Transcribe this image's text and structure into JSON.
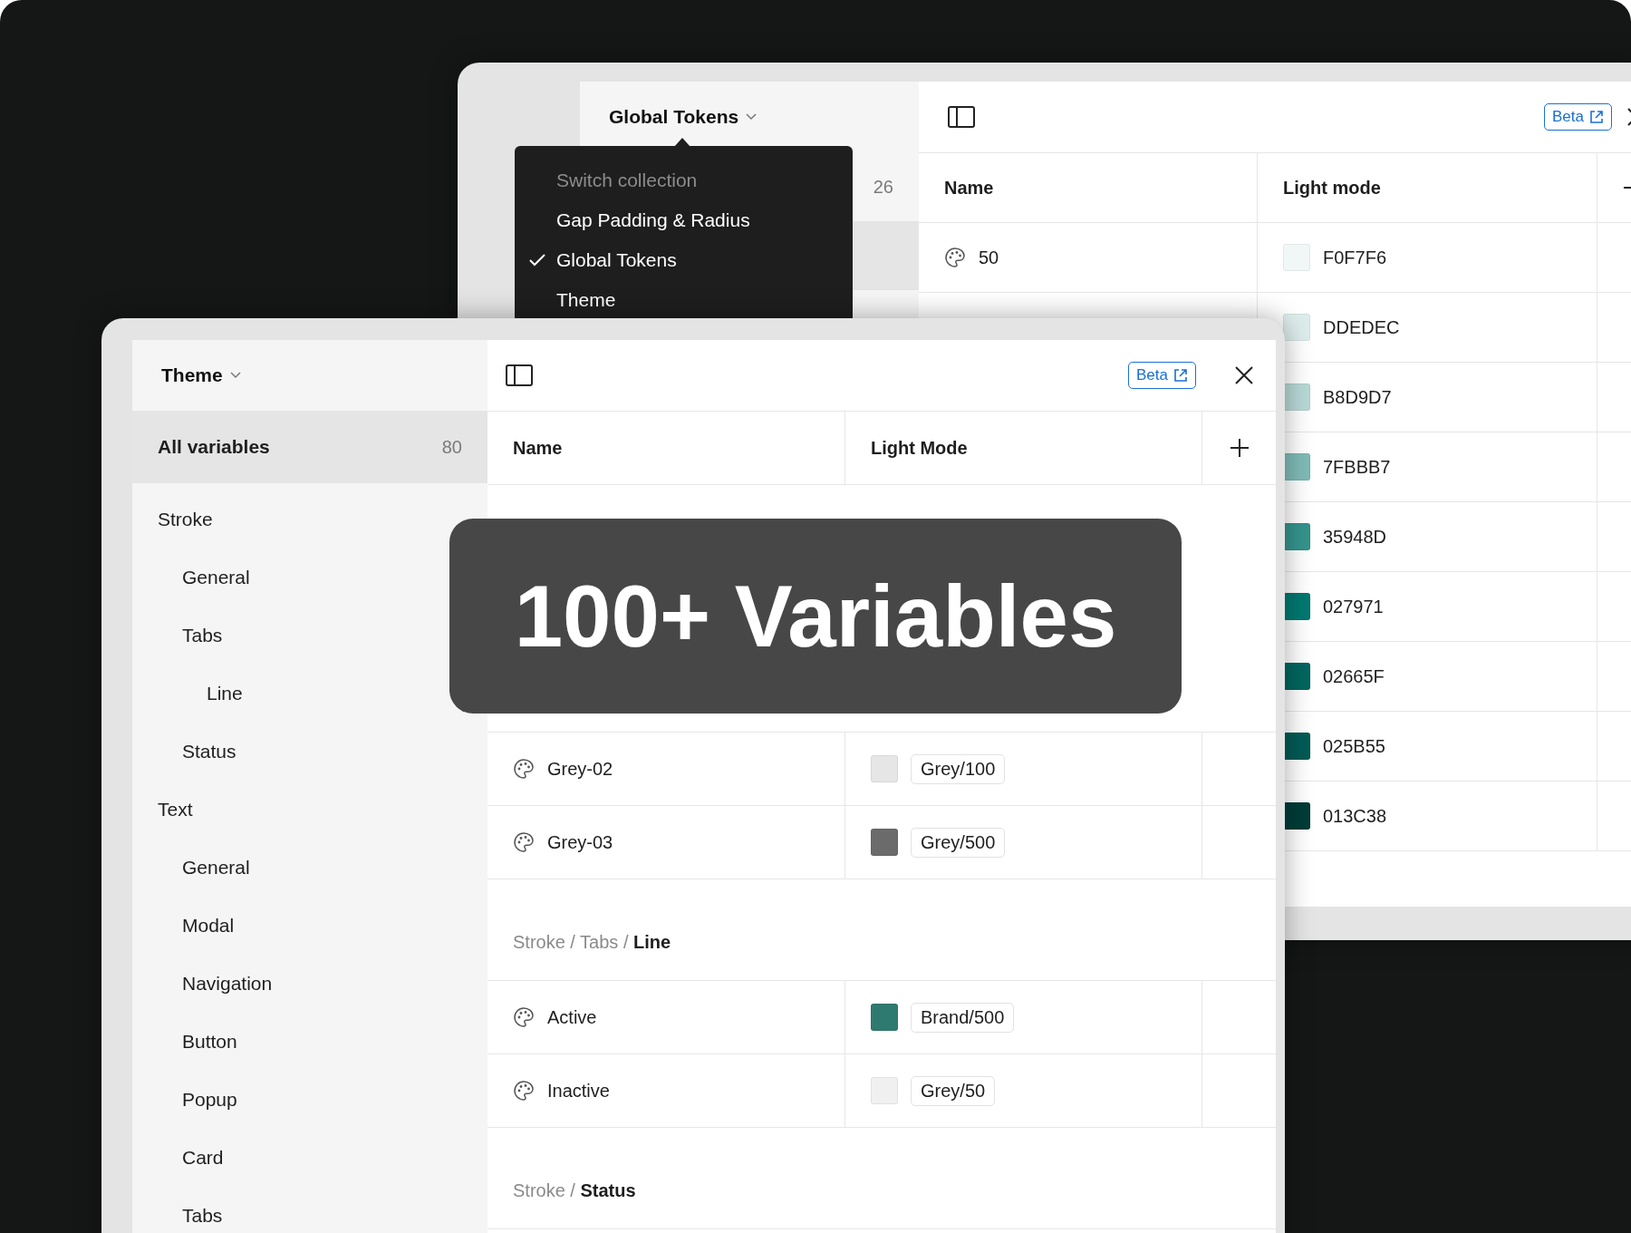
{
  "back_window": {
    "collection": "Global Tokens",
    "badge": "Beta",
    "columns": [
      "Name",
      "Light mode"
    ],
    "sidebar_rows": [
      {
        "count": "26",
        "selected": false
      },
      {
        "selected": true
      }
    ],
    "menu": {
      "title": "Switch collection",
      "items": [
        {
          "label": "Gap Padding & Radius",
          "selected": false
        },
        {
          "label": "Global Tokens",
          "selected": true
        },
        {
          "label": "Theme",
          "selected": false
        }
      ]
    },
    "rows": [
      {
        "name": "50",
        "value": "F0F7F6",
        "color": "#f0f7f6"
      },
      {
        "value": "DDEDEC",
        "color": "#ddedec"
      },
      {
        "value": "B8D9D7",
        "color": "#b8d9d7"
      },
      {
        "value": "7FBBB7",
        "color": "#7fbbb7"
      },
      {
        "value": "35948D",
        "color": "#35948d"
      },
      {
        "value": "027971",
        "color": "#027971"
      },
      {
        "value": "02665F",
        "color": "#02665f"
      },
      {
        "value": "025B55",
        "color": "#025b55"
      },
      {
        "value": "013C38",
        "color": "#013c38"
      }
    ]
  },
  "front_window": {
    "collection": "Theme",
    "badge": "Beta",
    "columns": [
      "Name",
      "Light Mode"
    ],
    "all_variables": {
      "label": "All variables",
      "count": "80",
      "selected": true
    },
    "sidebar": [
      {
        "label": "Stroke",
        "selected": false,
        "children": [
          {
            "label": "General",
            "selected": false
          },
          {
            "label": "Tabs",
            "selected": false,
            "children": [
              {
                "label": "Line",
                "selected": false
              }
            ]
          },
          {
            "label": "Status",
            "selected": false
          }
        ]
      },
      {
        "label": "Text",
        "selected": false,
        "children": [
          {
            "label": "General",
            "selected": false
          },
          {
            "label": "Modal",
            "selected": false
          },
          {
            "label": "Navigation",
            "selected": false
          },
          {
            "label": "Button",
            "selected": false
          },
          {
            "label": "Popup",
            "selected": false
          },
          {
            "label": "Card",
            "selected": false
          },
          {
            "label": "Tabs",
            "selected": false
          }
        ]
      }
    ],
    "groups": [
      {
        "rows": [
          {
            "name": "Grey-02",
            "value": "Grey/100",
            "color": "#e6e6e6"
          },
          {
            "name": "Grey-03",
            "value": "Grey/500",
            "color": "#6b6b6b"
          }
        ]
      },
      {
        "path": "Stroke / Tabs / **Line**",
        "rows": [
          {
            "name": "Active",
            "value": "Brand/500",
            "color": "#2f7a70"
          },
          {
            "name": "Inactive",
            "value": "Grey/50",
            "color": "#f0f0f0"
          }
        ]
      },
      {
        "path": "Stroke / **Status**"
      }
    ]
  },
  "overlay": {
    "text": "100+ Variables"
  }
}
